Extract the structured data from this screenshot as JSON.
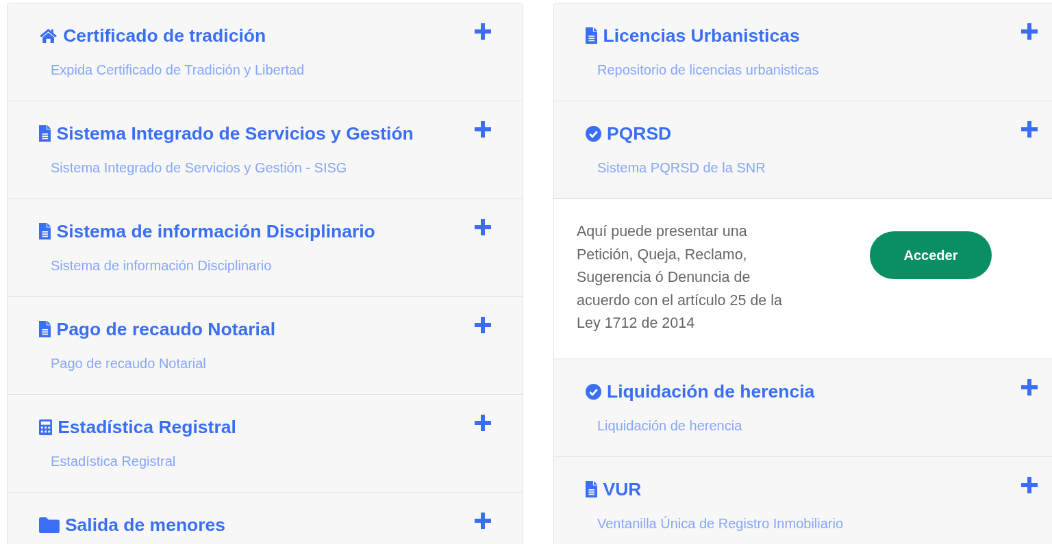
{
  "columns": [
    {
      "panels": [
        {
          "kind": "home",
          "title": "Certificado de tradición",
          "subtitle": "Expida Certificado de Tradición y Libertad",
          "expanded": false
        },
        {
          "kind": "file",
          "title": "Sistema Integrado de Servicios y Gestión",
          "subtitle": "Sistema Integrado de Servicios y Gestión - SISG",
          "expanded": false
        },
        {
          "kind": "file",
          "title": "Sistema de información Disciplinario",
          "subtitle": "Sistema de información Disciplinario",
          "expanded": false
        },
        {
          "kind": "file",
          "title": "Pago de recaudo Notarial",
          "subtitle": "Pago de recaudo Notarial",
          "expanded": false
        },
        {
          "kind": "calculator",
          "title": "Estadística Registral",
          "subtitle": "Estadística Registral",
          "expanded": false
        },
        {
          "kind": "folder",
          "title": "Salida de menores",
          "expanded": false
        }
      ]
    },
    {
      "panels": [
        {
          "kind": "file",
          "title": "Licencias Urbanisticas",
          "subtitle": "Repositorio de licencias urbanisticas",
          "expanded": false
        },
        {
          "kind": "check",
          "title": "PQRSD",
          "subtitle": "Sistema PQRSD de la SNR",
          "expanded": true,
          "body": "Aquí puede presentar una Petición, Queja, Reclamo, Sugerencia ó Denuncia de acuerdo con el artículo 25 de la Ley 1712 de 2014",
          "button": "Acceder"
        },
        {
          "kind": "check",
          "title": "Liquidación de herencia",
          "subtitle": "Liquidación de herencia",
          "expanded": false
        },
        {
          "kind": "file",
          "title": "VUR",
          "subtitle": "Ventanilla Única de Registro Inmobiliario",
          "expanded": false
        }
      ]
    }
  ]
}
